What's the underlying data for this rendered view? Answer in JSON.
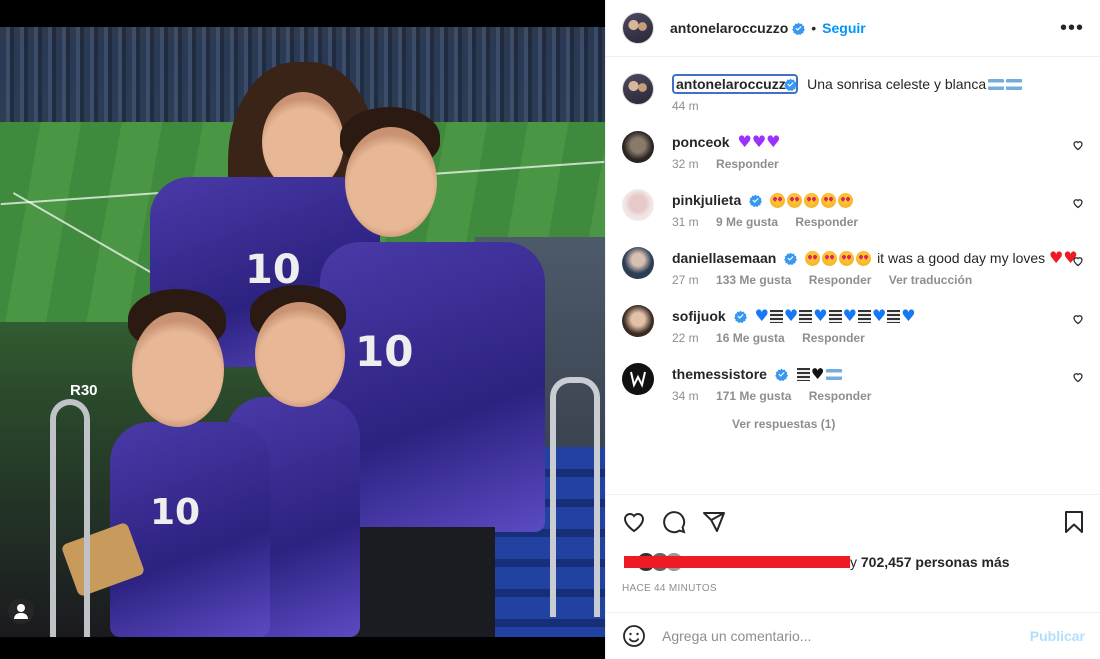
{
  "post": {
    "author": "antonelaroccuzzo",
    "follow_label": "Seguir",
    "more_label": "•••",
    "caption_text": "Una sonrisa celeste y blanca",
    "caption_time": "44 m",
    "jersey_number": "10",
    "stadium_board": "R30"
  },
  "comments": [
    {
      "user": "ponceok",
      "verified": false,
      "text": "",
      "emoji": "purple-hearts-x3",
      "time": "32 m",
      "likes": "",
      "reply_label": "Responder",
      "translate_label": ""
    },
    {
      "user": "pinkjulieta",
      "verified": true,
      "text": "",
      "emoji": "heart-eyes-x5",
      "time": "31 m",
      "likes": "9 Me gusta",
      "reply_label": "Responder",
      "translate_label": ""
    },
    {
      "user": "daniellasemaan",
      "verified": true,
      "text": "it was a good day my loves",
      "emoji": "heart-eyes-x4,red-hearts-x2",
      "time": "27 m",
      "likes": "133 Me gusta",
      "reply_label": "Responder",
      "translate_label": "Ver traducción"
    },
    {
      "user": "sofijuok",
      "verified": true,
      "text": "",
      "emoji": "blue-hearts-flag-pattern",
      "time": "22 m",
      "likes": "16 Me gusta",
      "reply_label": "Responder",
      "translate_label": ""
    },
    {
      "user": "themessistore",
      "verified": true,
      "text": "",
      "emoji": "flag-black-heart-flag",
      "time": "34 m",
      "likes": "171 Me gusta",
      "reply_label": "Responder",
      "translate_label": ""
    }
  ],
  "view_replies": "Ver respuestas (1)",
  "likes": {
    "suffix_prefix": "y ",
    "count": "702,457",
    "suffix": " personas más"
  },
  "time_ago": "HACE 44 MINUTOS",
  "add_comment": {
    "placeholder": "Agrega un comentario...",
    "publish_label": "Publicar"
  },
  "colors": {
    "link_blue": "#0095f6",
    "publish_disabled": "#b2dffc",
    "verified_blue": "#3897f0",
    "redaction_red": "#ee1b24",
    "caption_highlight": "#4171c4"
  }
}
